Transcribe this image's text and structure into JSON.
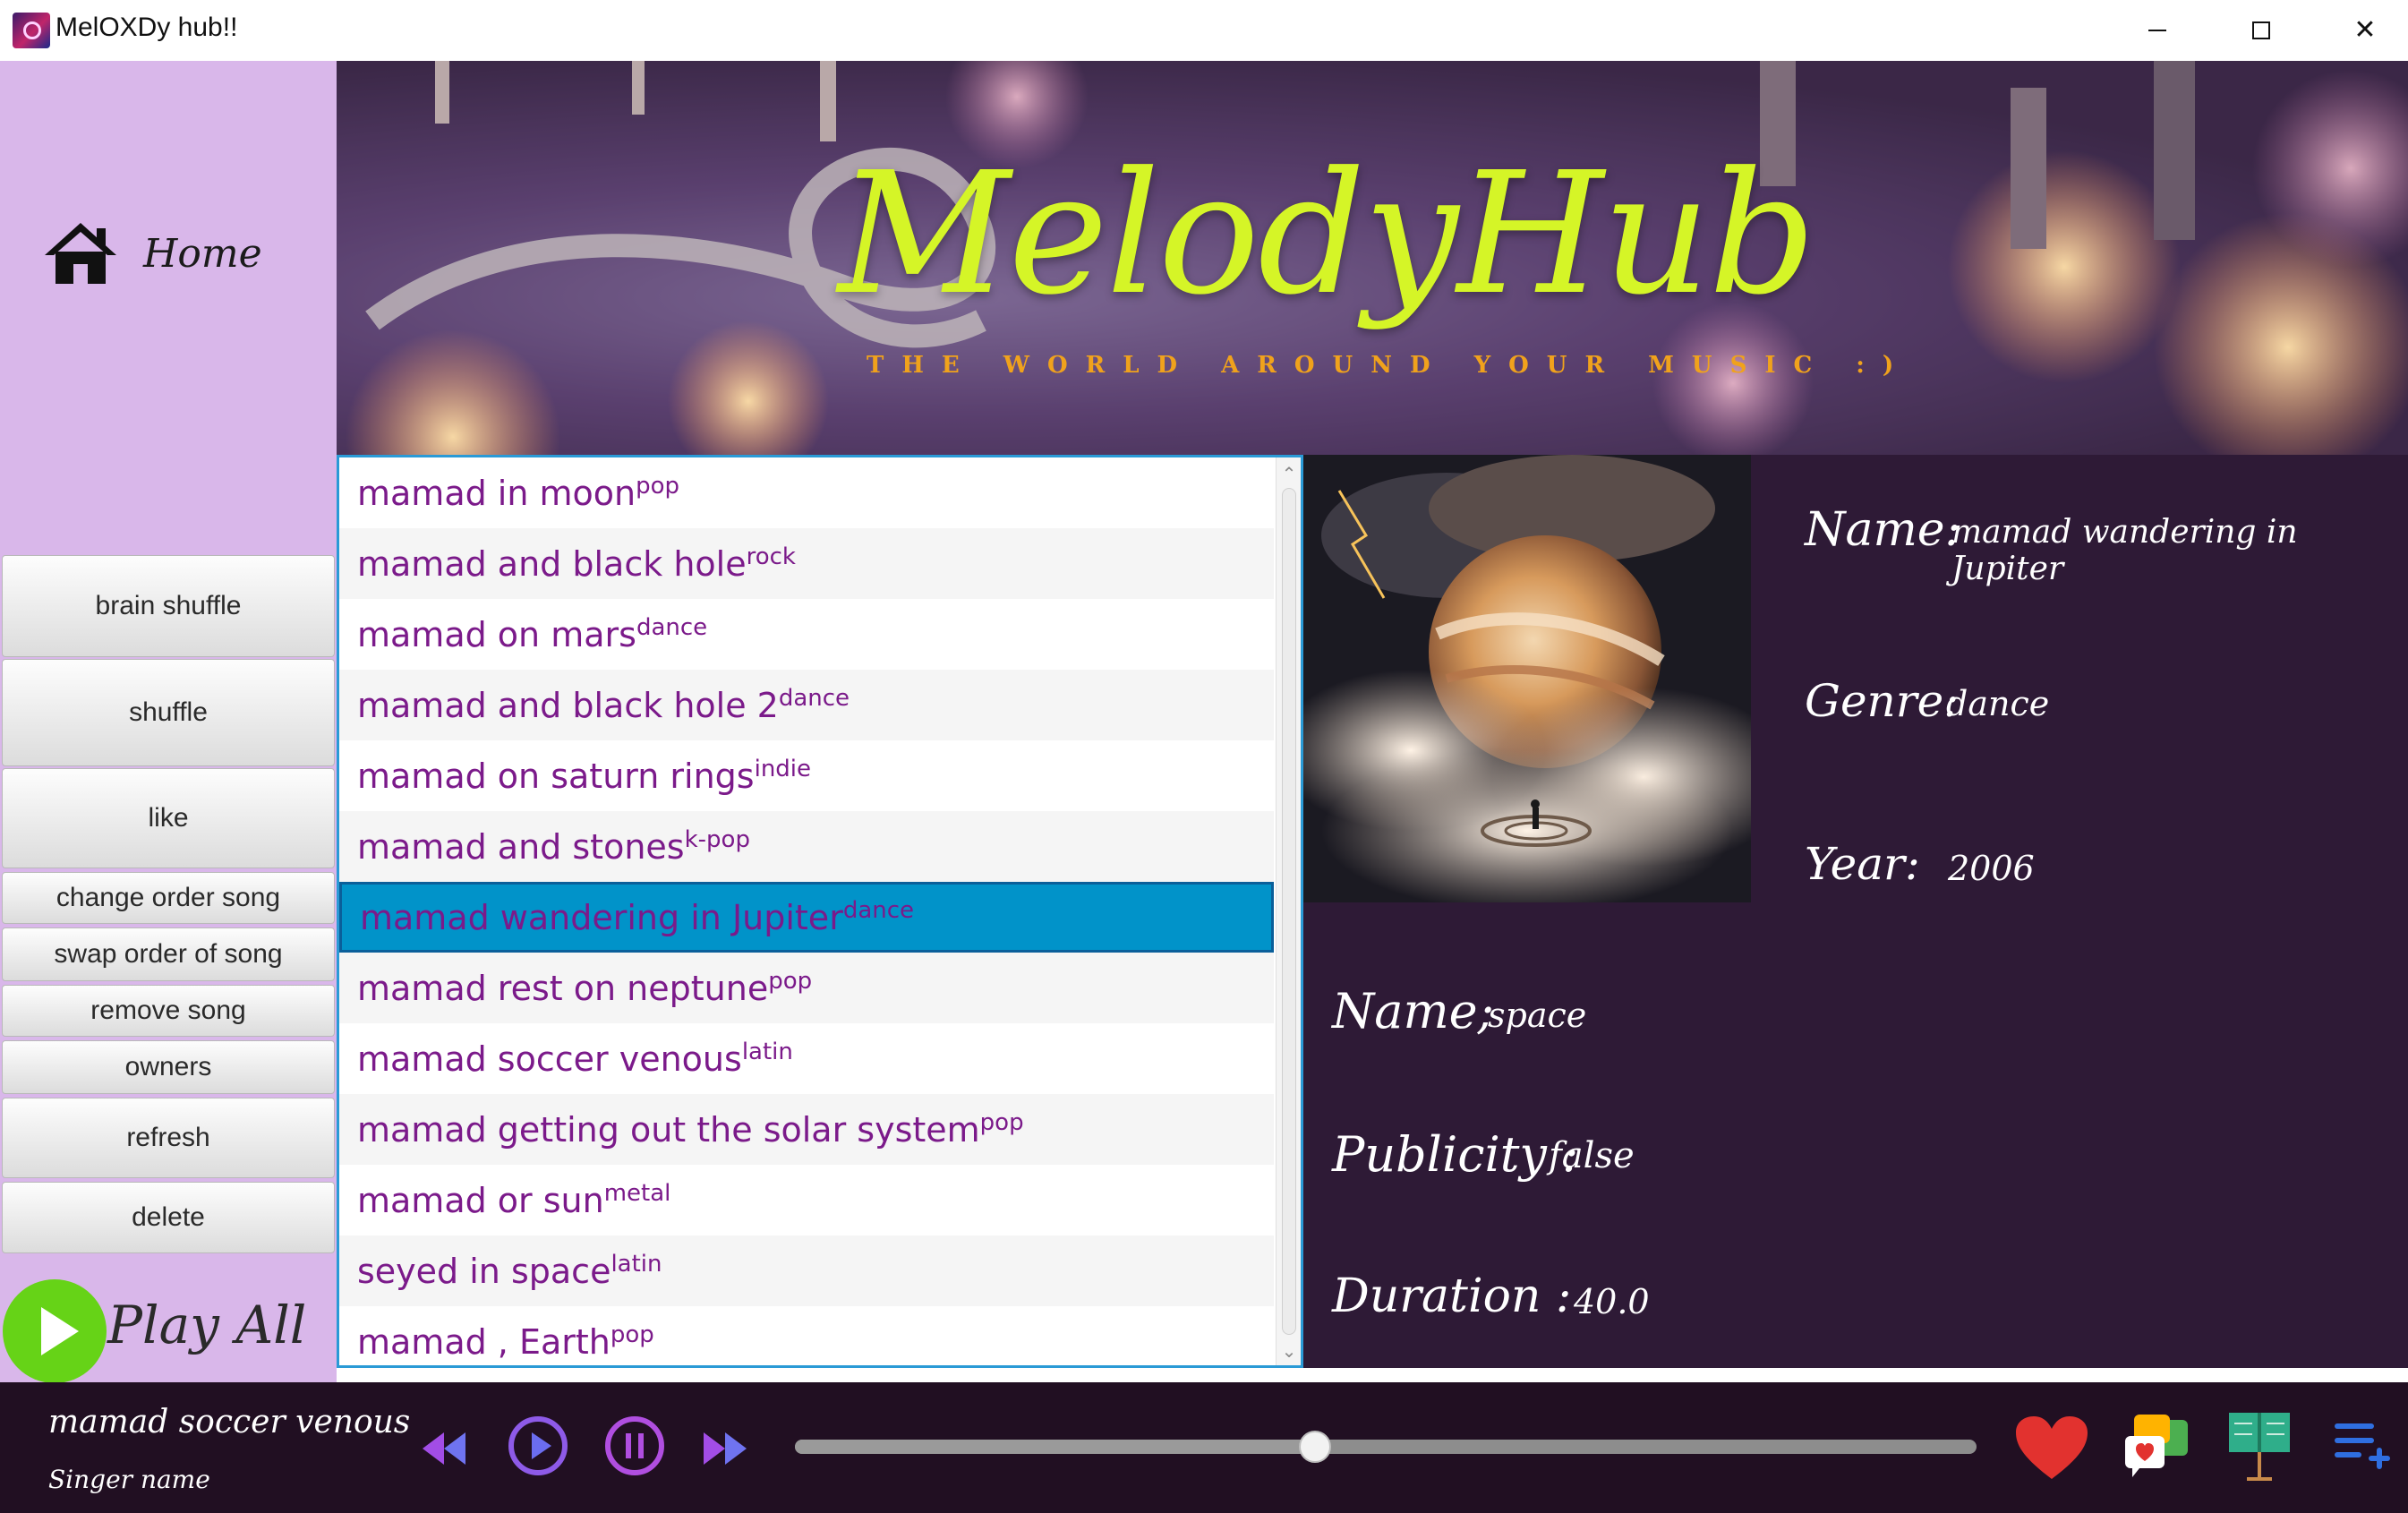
{
  "window": {
    "title": "MelOXDy hub!!"
  },
  "sidebar": {
    "home_label": "Home",
    "buttons": [
      {
        "label": "brain shuffle"
      },
      {
        "label": "shuffle"
      },
      {
        "label": "like"
      },
      {
        "label": "change order song"
      },
      {
        "label": "swap order of song"
      },
      {
        "label": "remove song"
      },
      {
        "label": "owners"
      },
      {
        "label": "refresh"
      },
      {
        "label": "delete"
      }
    ],
    "play_all_label": "Play All"
  },
  "banner": {
    "title": "MelodyHub",
    "subtitle": "THE WORLD AROUND YOUR MUSIC :)"
  },
  "song_list": {
    "selected_index": 6,
    "songs": [
      {
        "title": "mamad in moon",
        "genre": "pop"
      },
      {
        "title": "mamad and black hole",
        "genre": "rock"
      },
      {
        "title": "mamad on mars",
        "genre": "dance"
      },
      {
        "title": "mamad and black hole 2",
        "genre": "dance"
      },
      {
        "title": "mamad on saturn rings",
        "genre": "indie"
      },
      {
        "title": "mamad and stones",
        "genre": "k-pop"
      },
      {
        "title": "mamad wandering in Jupiter",
        "genre": "dance"
      },
      {
        "title": "mamad rest on neptune",
        "genre": "pop"
      },
      {
        "title": "mamad soccer venous",
        "genre": "latin"
      },
      {
        "title": "mamad getting out the solar system",
        "genre": "pop"
      },
      {
        "title": "mamad or sun",
        "genre": "metal"
      },
      {
        "title": "seyed in space",
        "genre": "latin"
      },
      {
        "title": "mamad , Earth",
        "genre": "pop"
      }
    ]
  },
  "song_info": {
    "name_label": "Name:",
    "name_value": "mamad wandering in Jupiter",
    "genre_label": "Genre:",
    "genre_value": "dance",
    "year_label": "Year:",
    "year_value": "2006"
  },
  "playlist_info": {
    "name_label": "Name;",
    "name_value": "space",
    "publicity_label": "Publicity :",
    "publicity_value": "false",
    "duration_label": "Duration :",
    "duration_value": "40.0"
  },
  "player": {
    "now_playing_title": "mamad soccer venous",
    "singer_label": "Singer name",
    "progress": 0.44,
    "icons": [
      "rewind-icon",
      "play-icon",
      "pause-icon",
      "fast-forward-icon",
      "heart-icon",
      "comments-icon",
      "lyrics-book-icon",
      "add-to-playlist-icon"
    ]
  },
  "colors": {
    "sidebar_bg": "#d9b7ea",
    "info_bg": "#2e1a36",
    "player_bg": "#210f22",
    "selected_row": "#0193c9",
    "song_text": "#7b1a8a",
    "banner_title": "#d5f527",
    "banner_subtitle": "#f0a21c",
    "play_all_green": "#66d317"
  }
}
